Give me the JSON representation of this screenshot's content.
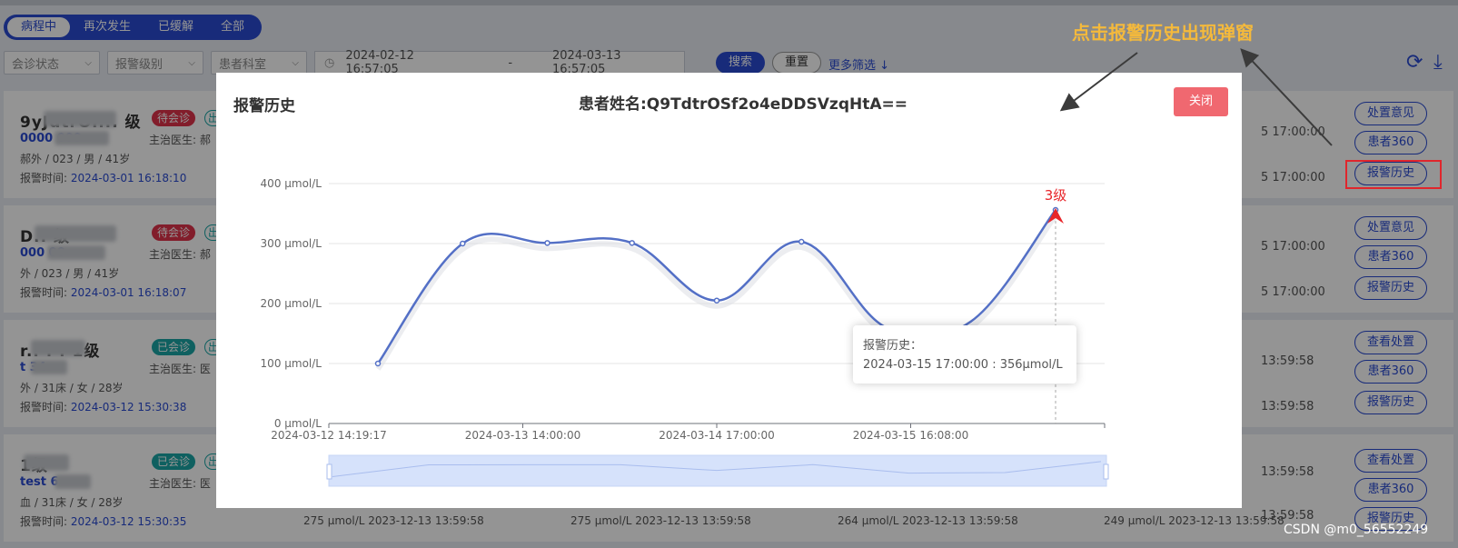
{
  "tabs": [
    {
      "label": "病程中",
      "active": true
    },
    {
      "label": "再次发生",
      "active": false
    },
    {
      "label": "已缓解",
      "active": false
    },
    {
      "label": "全部",
      "active": false
    }
  ],
  "filters": {
    "consult_status": "会诊状态",
    "alarm_level": "报警级别",
    "department": "患者科室",
    "date_from": "2024-02-12 16:57:05",
    "date_sep": "-",
    "date_to": "2024-03-13 16:57:05",
    "search_label": "搜索",
    "reset_label": "重置",
    "more_label": "更多筛选",
    "more_icon": "↓",
    "calendar_icon": "◷",
    "chevron_icon": "⌵"
  },
  "toolbar": {
    "refresh_icon": "⟳",
    "download_icon": "⤓"
  },
  "cards": [
    {
      "name": "9yJdtrOi... 级",
      "status": "待会诊",
      "status_color": "red",
      "out_badge": "出",
      "id": "0000       000",
      "doctor": "主治医生: 郝",
      "info": "郝外 / 023 / 男 / 41岁",
      "alarm_label": "报警时间:",
      "alarm_time": "2024-03-01 16:18:10",
      "right_times": [
        "5 17:00:00",
        "5 17:00:00"
      ],
      "actions": [
        "处置意见",
        "患者360",
        "报警历史"
      ]
    },
    {
      "name": "D..      级",
      "status": "待会诊",
      "status_color": "red",
      "out_badge": "出",
      "id": "000        00",
      "doctor": "主治医生: 郝",
      "info": "外 / 023 / 男 / 41岁",
      "alarm_label": "报警时间:",
      "alarm_time": "2024-03-01 16:18:07",
      "right_times": [
        "5 17:00:00",
        "5 17:00:00"
      ],
      "actions": [
        "处置意见",
        "患者360",
        "报警历史"
      ]
    },
    {
      "name": "r.. . .  1级",
      "status": "已会诊",
      "status_color": "teal",
      "out_badge": "出",
      "id": "t   34",
      "doctor": "主治医生: 医",
      "info": "外 / 31床 / 女 / 28岁",
      "alarm_label": "报警时间:",
      "alarm_time": "2024-03-12 15:30:38",
      "right_times": [
        "13:59:58",
        "13:59:58"
      ],
      "actions": [
        "查看处置",
        "患者360",
        "报警历史"
      ]
    },
    {
      "name": "      1级",
      "status": "已会诊",
      "status_color": "teal",
      "out_badge": "出",
      "id": "test      6",
      "doctor": "主治医生: 医",
      "info": "血 / 31床 / 女 / 28岁",
      "alarm_label": "报警时间:",
      "alarm_time": "2024-03-12 15:30:35",
      "right_times": [
        "13:59:58",
        "13:59:58"
      ],
      "actions": [
        "查看处置",
        "患者360",
        "报警历史"
      ]
    }
  ],
  "bottom_row": [
    "275 μmol/L  2023-12-13 13:59:58",
    "275 μmol/L  2023-12-13 13:59:58",
    "264 μmol/L  2023-12-13 13:59:58",
    "249 μmol/L  2023-12-13 13:59:58"
  ],
  "modal": {
    "title": "报警历史",
    "patient_label": "患者姓名:",
    "patient_name": "Q9TdtrOSf2o4eDDSVzqHtA==",
    "close_label": "关闭",
    "tooltip_title": "报警历史：",
    "tooltip_value": "2024-03-15 17:00:00 : 356μmol/L"
  },
  "chart_data": {
    "type": "line",
    "title": "",
    "xlabel": "",
    "ylabel": "",
    "ylim": [
      0,
      400
    ],
    "y_ticks": [
      "0 μmol/L",
      "100 μmol/L",
      "200 μmol/L",
      "300 μmol/L",
      "400 μmol/L"
    ],
    "x_ticks": [
      "2024-03-12 14:19:17",
      "2024-03-13 14:00:00",
      "2024-03-14 17:00:00",
      "2024-03-15 16:08:00"
    ],
    "values": [
      100,
      300,
      301,
      301,
      205,
      303,
      160,
      170,
      356
    ],
    "smooth": true,
    "grid": true,
    "color": "#5470c6",
    "highlight": {
      "index": 8,
      "label": "3级",
      "label_color": "#e8252a",
      "marker_color": "#e8252a"
    },
    "zoom_slider": true
  },
  "annotation": {
    "text": "点击报警历史出现弹窗",
    "text_color": "#f4b93c",
    "box_color": "#e0262c"
  },
  "watermark": "CSDN @m0_56552249"
}
